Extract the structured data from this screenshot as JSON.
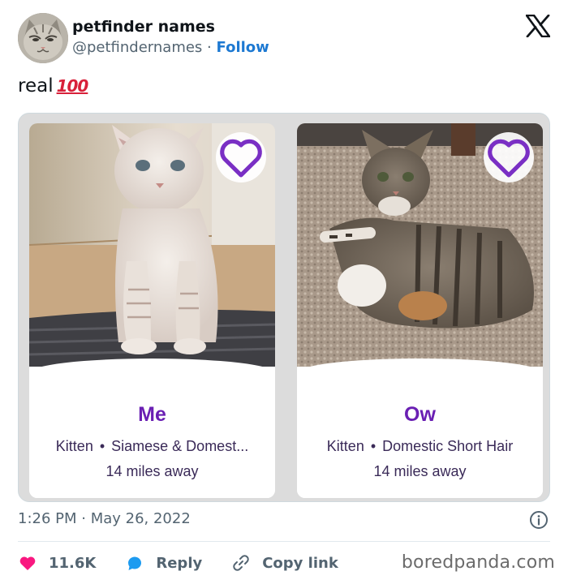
{
  "author": {
    "display_name": "petfinder names",
    "handle": "@petfindernames",
    "separator": "·",
    "follow_label": "Follow",
    "avatar_icon": "cat-avatar-icon"
  },
  "platform_icon": "x-logo-icon",
  "tweet": {
    "text": "real",
    "emoji": "100"
  },
  "cards": [
    {
      "name": "Me",
      "age": "Kitten",
      "dot": "•",
      "breed": "Siamese & Domest...",
      "distance": "14 miles away",
      "photo_icon": "white-kitten-photo"
    },
    {
      "name": "Ow",
      "age": "Kitten",
      "dot": "•",
      "breed": "Domestic Short Hair",
      "distance": "14 miles away",
      "photo_icon": "tabby-kitten-photo"
    }
  ],
  "timestamp": "1:26 PM · May 26, 2022",
  "actions": {
    "likes": "11.6K",
    "reply_label": "Reply",
    "copy_label": "Copy link"
  },
  "watermark": "boredpanda.com",
  "colors": {
    "follow": "#1d79d2",
    "heart": "#f91880",
    "reply": "#1d9bf0",
    "pet_name": "#6a1fb3",
    "card_heart": "#7a2fc4"
  }
}
